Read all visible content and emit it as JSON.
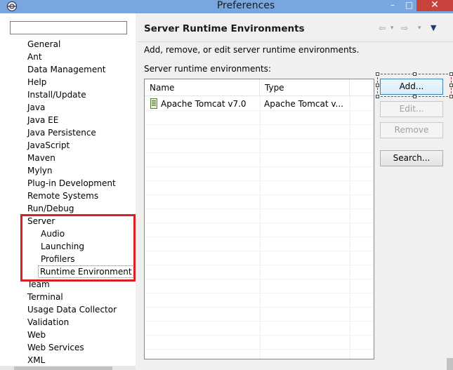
{
  "window": {
    "title": "Preferences",
    "min_glyph": "–",
    "max_glyph": "□",
    "close_glyph": "✕"
  },
  "tree": {
    "filter_value": "",
    "items": [
      "General",
      "Ant",
      "Data Management",
      "Help",
      "Install/Update",
      "Java",
      "Java EE",
      "Java Persistence",
      "JavaScript",
      "Maven",
      "Mylyn",
      "Plug-in Development",
      "Remote Systems",
      "Run/Debug",
      "Server"
    ],
    "server_children": [
      "Audio",
      "Launching",
      "Profilers",
      "Runtime Environment"
    ],
    "items_after": [
      "Team",
      "Terminal",
      "Usage Data Collector",
      "Validation",
      "Web",
      "Web Services",
      "XML"
    ]
  },
  "page": {
    "title": "Server Runtime Environments",
    "description": "Add, remove, or edit server runtime environments.",
    "list_label": "Server runtime environments:",
    "nav": {
      "back": "⇦",
      "menu": "▾",
      "forward": "⇨",
      "view_menu": "▼"
    }
  },
  "table": {
    "columns": [
      "Name",
      "Type"
    ],
    "rows": [
      {
        "name": "Apache Tomcat v7.0",
        "type": "Apache Tomcat v..."
      }
    ]
  },
  "buttons": {
    "add": "Add...",
    "edit": "Edit...",
    "remove": "Remove",
    "search": "Search..."
  },
  "colors": {
    "highlight": "#d82020",
    "titlebar": "#7aa6e0",
    "close": "#c8433b"
  }
}
